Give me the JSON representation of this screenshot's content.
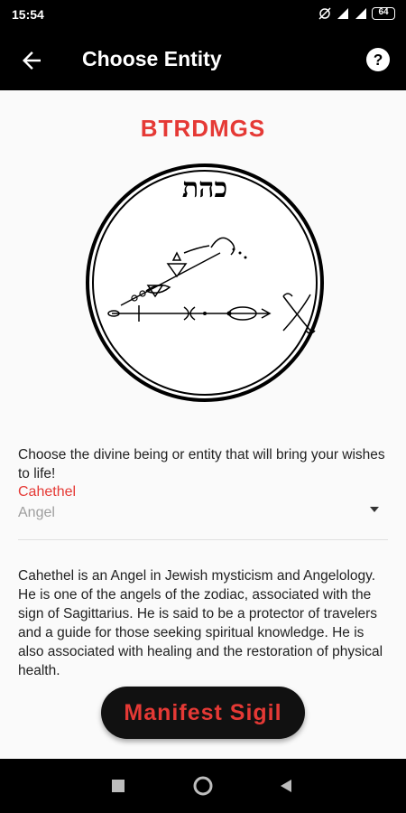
{
  "status": {
    "time": "15:54",
    "battery": "64"
  },
  "appbar": {
    "title": "Choose Entity"
  },
  "main": {
    "code": "BTRDMGS",
    "sigil_hebrew": "כהת",
    "prompt": "Choose the divine being or entity that will bring your wishes to life!",
    "entity": {
      "name": "Cahethel",
      "type": "Angel"
    },
    "description": "Cahethel is an Angel in Jewish mysticism and Angelology. He is one of the angels of the zodiac, associated with the sign of Sagittarius. He is said to be a protector of travelers and a guide for those seeking spiritual knowledge. He is also associated with healing and the restoration of physical health.",
    "button_label": "Manifest Sigil"
  },
  "colors": {
    "accent": "#e53935",
    "bar": "#000000",
    "button": "#111111"
  },
  "icons": {
    "back": "arrow-back-icon",
    "help": "help-icon",
    "dropdown": "dropdown-arrow-icon"
  }
}
